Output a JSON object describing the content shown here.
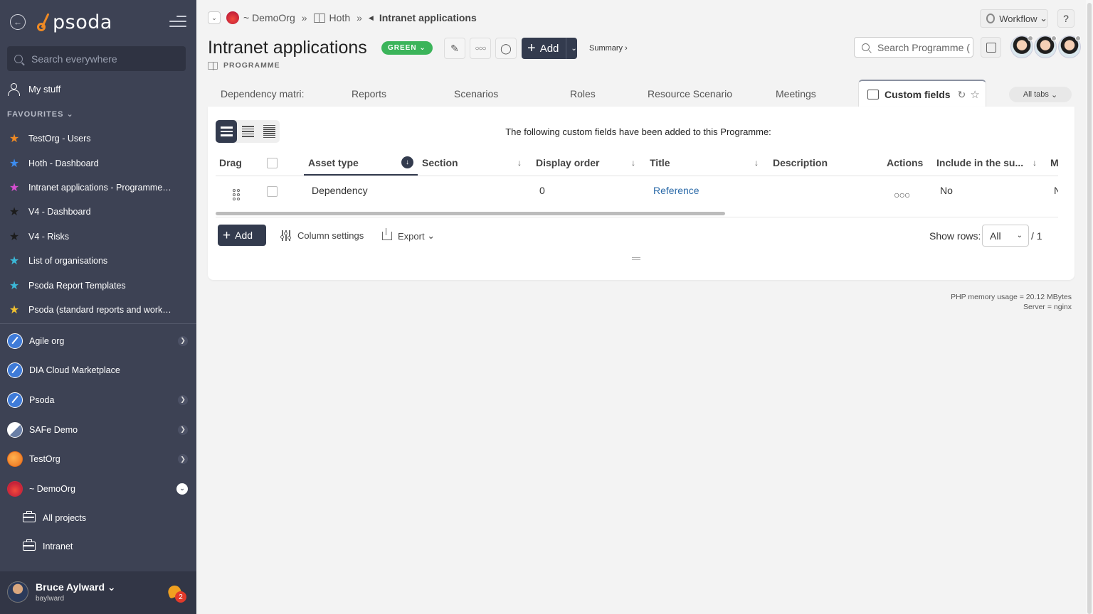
{
  "app": {
    "logo_text": "psoda"
  },
  "sidebar": {
    "search_placeholder": "Search everywhere",
    "my_stuff": "My stuff",
    "favourites_label": "FAVOURITES",
    "favourites": [
      {
        "label": "TestOrg - Users",
        "color": "#f08a24"
      },
      {
        "label": "Hoth - Dashboard",
        "color": "#3d8df0"
      },
      {
        "label": "Intranet applications - Programme…",
        "color": "#d64ed0"
      },
      {
        "label": "V4 - Dashboard",
        "color": "#1c1c1c"
      },
      {
        "label": "V4 - Risks",
        "color": "#1c1c1c"
      },
      {
        "label": "List of organisations",
        "color": "#3bb8d8"
      },
      {
        "label": "Psoda Report Templates",
        "color": "#3bb8d8"
      },
      {
        "label": "Psoda (standard reports and work…",
        "color": "#f0c030"
      }
    ],
    "orgs": [
      {
        "label": "Agile org",
        "logo": "blue",
        "chevron": true
      },
      {
        "label": "DIA Cloud Marketplace",
        "logo": "blue",
        "chevron": false
      },
      {
        "label": "Psoda",
        "logo": "blue",
        "chevron": true
      },
      {
        "label": "SAFe Demo",
        "logo": "safe",
        "chevron": true
      },
      {
        "label": "TestOrg",
        "logo": "orange",
        "chevron": true
      },
      {
        "label": "~ DemoOrg",
        "logo": "red",
        "chevron": true
      }
    ],
    "sub_items": [
      "All projects",
      "Intranet"
    ],
    "user": {
      "name": "Bruce Aylward",
      "login": "baylward",
      "notification_count": "2"
    }
  },
  "breadcrumb": {
    "org": "~ DemoOrg",
    "sep": "»",
    "parent": "Hoth",
    "current": "Intranet applications"
  },
  "header": {
    "title": "Intranet applications",
    "status": "GREEN",
    "type_label": "PROGRAMME",
    "add_label": "Add",
    "summary_label": "Summary ›",
    "workflow_label": "Workflow",
    "help_label": "?",
    "search_placeholder": "Search Programme (",
    "avatars_count": 3
  },
  "tabs": {
    "items": [
      "Dependency matri:",
      "Reports",
      "Scenarios",
      "Roles",
      "Resource Scenario:",
      "Meetings"
    ],
    "active": "Custom fields",
    "all_tabs": "All tabs"
  },
  "panel": {
    "info": "The following custom fields have been added to this Programme:",
    "columns": [
      "Drag",
      "Asset type",
      "Section",
      "Display order",
      "Title",
      "Description",
      "Actions",
      "Include in the su...",
      "M."
    ],
    "rows": [
      {
        "asset_type": "Dependency",
        "section": "",
        "display_order": "0",
        "title": "Reference",
        "description": "",
        "include": "No",
        "m": "N"
      }
    ],
    "add_label": "Add",
    "column_settings": "Column settings",
    "export": "Export",
    "show_rows_label": "Show rows:",
    "show_rows_value": "All",
    "page_total": "/ 1"
  },
  "footer": {
    "memory": "PHP memory usage = 20.12 MBytes",
    "server": "Server = nginx"
  }
}
